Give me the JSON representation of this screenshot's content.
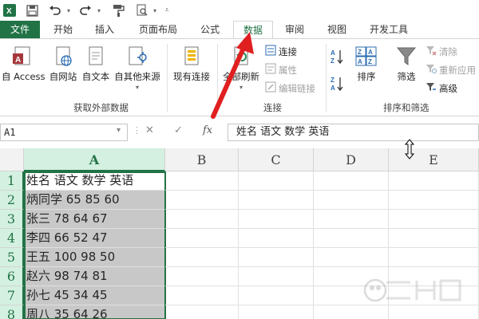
{
  "qat": {
    "icons": [
      "excel-logo-icon",
      "save-icon",
      "undo-icon",
      "redo-icon",
      "format-painter-icon",
      "print-preview-icon",
      "customize-icon"
    ]
  },
  "tabs": [
    {
      "label": "文件",
      "state": "file"
    },
    {
      "label": "开始",
      "state": "normal"
    },
    {
      "label": "插入",
      "state": "normal"
    },
    {
      "label": "页面布局",
      "state": "normal"
    },
    {
      "label": "公式",
      "state": "normal"
    },
    {
      "label": "数据",
      "state": "active"
    },
    {
      "label": "审阅",
      "state": "normal"
    },
    {
      "label": "视图",
      "state": "normal"
    },
    {
      "label": "开发工具",
      "state": "normal"
    }
  ],
  "ribbon": {
    "get_external": {
      "buttons": [
        "自 Access",
        "自网站",
        "自文本",
        "自其他来源"
      ],
      "group_name": "获取外部数据"
    },
    "existing_connections": "现有连接",
    "refresh_all": "全部刷新",
    "connections": {
      "items": [
        "连接",
        "属性",
        "编辑链接"
      ],
      "group_name": "连接"
    },
    "sort": {
      "sort_label": "排序",
      "filter_label": "筛选",
      "clear": "清除",
      "reapply": "重新应用",
      "advanced": "高级",
      "group_name": "排序和筛选"
    }
  },
  "formula_bar": {
    "name_box": "A1",
    "cancel": "✕",
    "enter": "✓",
    "fx": "fx",
    "content": "姓名 语文 数学 英语"
  },
  "grid": {
    "columns": [
      "A",
      "B",
      "C",
      "D",
      "E"
    ],
    "rows": [
      "1",
      "2",
      "3",
      "4",
      "5",
      "6",
      "7",
      "8"
    ],
    "cells": [
      "姓名 语文 数学 英语",
      "炳同学 65 85 60",
      "张三 78 64 67",
      "李四 66 52 47",
      "王五 100 98 50",
      "赵六 98 74 81",
      "孙七 45 34 45",
      "周八 35 64 26"
    ]
  },
  "colors": {
    "accent": "#217346",
    "annotation_arrow": "#e02020",
    "selection_fill": "#c8c8c8"
  }
}
